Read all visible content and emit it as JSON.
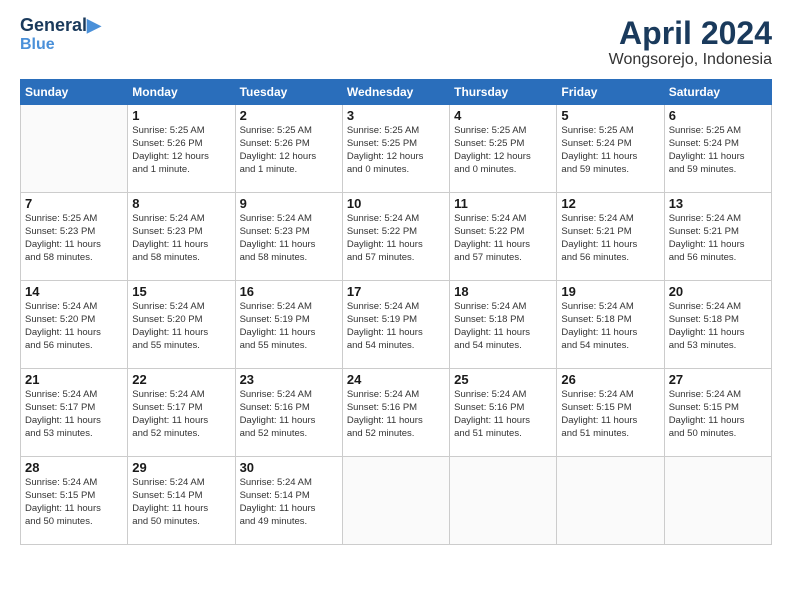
{
  "header": {
    "logo_line1": "General",
    "logo_line2": "Blue",
    "title": "April 2024",
    "subtitle": "Wongsorejo, Indonesia"
  },
  "weekdays": [
    "Sunday",
    "Monday",
    "Tuesday",
    "Wednesday",
    "Thursday",
    "Friday",
    "Saturday"
  ],
  "weeks": [
    [
      {
        "day": "",
        "info": ""
      },
      {
        "day": "1",
        "info": "Sunrise: 5:25 AM\nSunset: 5:26 PM\nDaylight: 12 hours\nand 1 minute."
      },
      {
        "day": "2",
        "info": "Sunrise: 5:25 AM\nSunset: 5:26 PM\nDaylight: 12 hours\nand 1 minute."
      },
      {
        "day": "3",
        "info": "Sunrise: 5:25 AM\nSunset: 5:25 PM\nDaylight: 12 hours\nand 0 minutes."
      },
      {
        "day": "4",
        "info": "Sunrise: 5:25 AM\nSunset: 5:25 PM\nDaylight: 12 hours\nand 0 minutes."
      },
      {
        "day": "5",
        "info": "Sunrise: 5:25 AM\nSunset: 5:24 PM\nDaylight: 11 hours\nand 59 minutes."
      },
      {
        "day": "6",
        "info": "Sunrise: 5:25 AM\nSunset: 5:24 PM\nDaylight: 11 hours\nand 59 minutes."
      }
    ],
    [
      {
        "day": "7",
        "info": "Sunrise: 5:25 AM\nSunset: 5:23 PM\nDaylight: 11 hours\nand 58 minutes."
      },
      {
        "day": "8",
        "info": "Sunrise: 5:24 AM\nSunset: 5:23 PM\nDaylight: 11 hours\nand 58 minutes."
      },
      {
        "day": "9",
        "info": "Sunrise: 5:24 AM\nSunset: 5:23 PM\nDaylight: 11 hours\nand 58 minutes."
      },
      {
        "day": "10",
        "info": "Sunrise: 5:24 AM\nSunset: 5:22 PM\nDaylight: 11 hours\nand 57 minutes."
      },
      {
        "day": "11",
        "info": "Sunrise: 5:24 AM\nSunset: 5:22 PM\nDaylight: 11 hours\nand 57 minutes."
      },
      {
        "day": "12",
        "info": "Sunrise: 5:24 AM\nSunset: 5:21 PM\nDaylight: 11 hours\nand 56 minutes."
      },
      {
        "day": "13",
        "info": "Sunrise: 5:24 AM\nSunset: 5:21 PM\nDaylight: 11 hours\nand 56 minutes."
      }
    ],
    [
      {
        "day": "14",
        "info": "Sunrise: 5:24 AM\nSunset: 5:20 PM\nDaylight: 11 hours\nand 56 minutes."
      },
      {
        "day": "15",
        "info": "Sunrise: 5:24 AM\nSunset: 5:20 PM\nDaylight: 11 hours\nand 55 minutes."
      },
      {
        "day": "16",
        "info": "Sunrise: 5:24 AM\nSunset: 5:19 PM\nDaylight: 11 hours\nand 55 minutes."
      },
      {
        "day": "17",
        "info": "Sunrise: 5:24 AM\nSunset: 5:19 PM\nDaylight: 11 hours\nand 54 minutes."
      },
      {
        "day": "18",
        "info": "Sunrise: 5:24 AM\nSunset: 5:18 PM\nDaylight: 11 hours\nand 54 minutes."
      },
      {
        "day": "19",
        "info": "Sunrise: 5:24 AM\nSunset: 5:18 PM\nDaylight: 11 hours\nand 54 minutes."
      },
      {
        "day": "20",
        "info": "Sunrise: 5:24 AM\nSunset: 5:18 PM\nDaylight: 11 hours\nand 53 minutes."
      }
    ],
    [
      {
        "day": "21",
        "info": "Sunrise: 5:24 AM\nSunset: 5:17 PM\nDaylight: 11 hours\nand 53 minutes."
      },
      {
        "day": "22",
        "info": "Sunrise: 5:24 AM\nSunset: 5:17 PM\nDaylight: 11 hours\nand 52 minutes."
      },
      {
        "day": "23",
        "info": "Sunrise: 5:24 AM\nSunset: 5:16 PM\nDaylight: 11 hours\nand 52 minutes."
      },
      {
        "day": "24",
        "info": "Sunrise: 5:24 AM\nSunset: 5:16 PM\nDaylight: 11 hours\nand 52 minutes."
      },
      {
        "day": "25",
        "info": "Sunrise: 5:24 AM\nSunset: 5:16 PM\nDaylight: 11 hours\nand 51 minutes."
      },
      {
        "day": "26",
        "info": "Sunrise: 5:24 AM\nSunset: 5:15 PM\nDaylight: 11 hours\nand 51 minutes."
      },
      {
        "day": "27",
        "info": "Sunrise: 5:24 AM\nSunset: 5:15 PM\nDaylight: 11 hours\nand 50 minutes."
      }
    ],
    [
      {
        "day": "28",
        "info": "Sunrise: 5:24 AM\nSunset: 5:15 PM\nDaylight: 11 hours\nand 50 minutes."
      },
      {
        "day": "29",
        "info": "Sunrise: 5:24 AM\nSunset: 5:14 PM\nDaylight: 11 hours\nand 50 minutes."
      },
      {
        "day": "30",
        "info": "Sunrise: 5:24 AM\nSunset: 5:14 PM\nDaylight: 11 hours\nand 49 minutes."
      },
      {
        "day": "",
        "info": ""
      },
      {
        "day": "",
        "info": ""
      },
      {
        "day": "",
        "info": ""
      },
      {
        "day": "",
        "info": ""
      }
    ]
  ]
}
